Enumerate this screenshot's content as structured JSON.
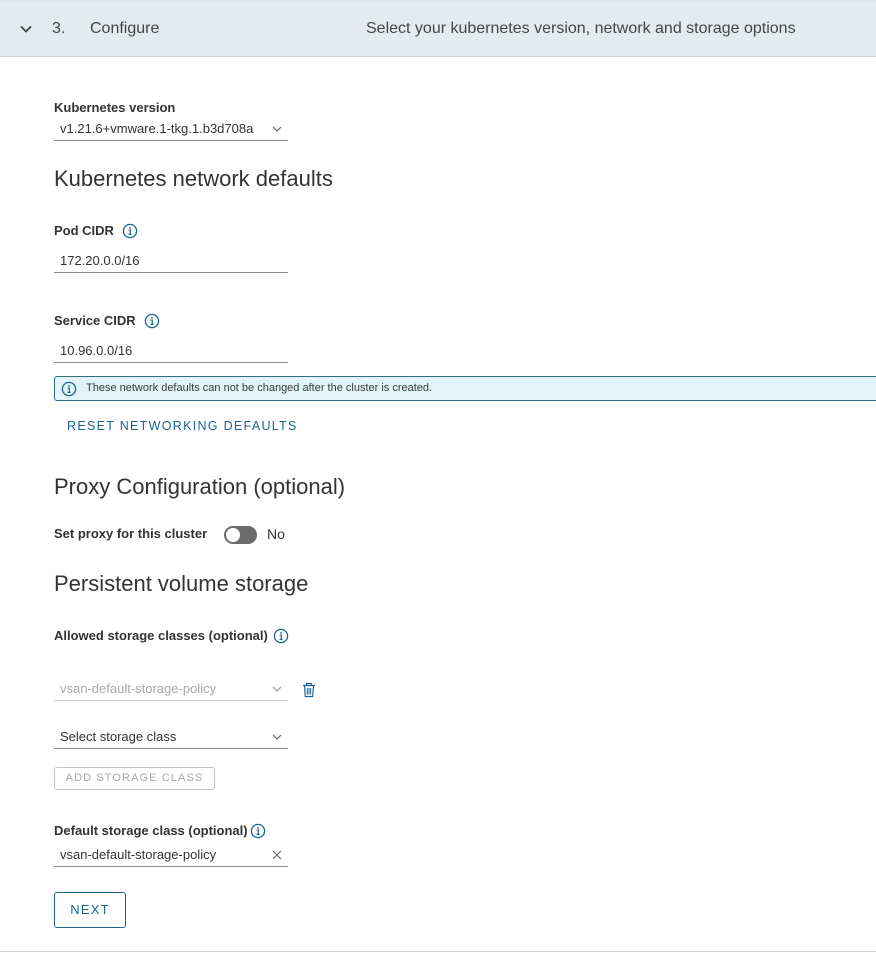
{
  "step": {
    "number": "3.",
    "title": "Configure",
    "description": "Select your kubernetes version, network and storage options"
  },
  "k8s_version": {
    "label": "Kubernetes version",
    "value": "v1.21.6+vmware.1-tkg.1.b3d708a"
  },
  "network": {
    "section_title": "Kubernetes network defaults",
    "pod_cidr_label": "Pod CIDR",
    "pod_cidr_value": "172.20.0.0/16",
    "service_cidr_label": "Service CIDR",
    "service_cidr_value": "10.96.0.0/16",
    "info_text": "These network defaults can not be changed after the cluster is created.",
    "reset_label": "RESET NETWORKING DEFAULTS"
  },
  "proxy": {
    "section_title": "Proxy Configuration (optional)",
    "toggle_label": "Set proxy for this cluster",
    "toggle_state": "No"
  },
  "storage": {
    "section_title": "Persistent volume storage",
    "allowed_label": "Allowed storage classes (optional)",
    "allowed_selected": "vsan-default-storage-policy",
    "select_placeholder": "Select storage class",
    "add_label": "ADD STORAGE CLASS",
    "default_label": "Default storage class (optional)",
    "default_value": "vsan-default-storage-policy"
  },
  "next_label": "NEXT",
  "colors": {
    "accent": "#1b6495",
    "header_bg": "#e4ebef",
    "info_bg": "#e1f5f8",
    "info_border": "#2d6e7e",
    "info_icon": "#1b6495"
  }
}
